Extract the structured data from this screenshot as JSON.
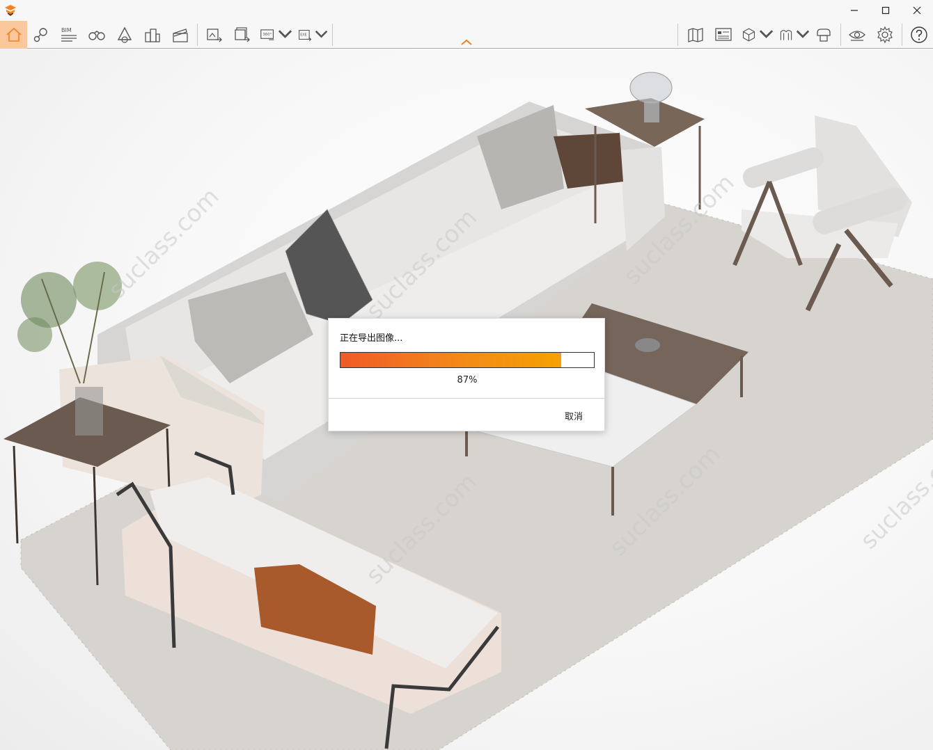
{
  "colors": {
    "accent": "#f58220",
    "home_active_bg": "#fbc79d",
    "progress_start": "#f05a28",
    "progress_end": "#f5a103"
  },
  "titlebar": {
    "icons": [
      "app-logo-icon",
      "minimize-icon",
      "maximize-icon",
      "close-icon"
    ]
  },
  "toolbar": {
    "bim_label": "BIM",
    "icon_360_label": "360°",
    "icon_exe_label": "EXE",
    "icons": [
      "home-icon",
      "location-icon",
      "bim-icon",
      "binoculars-icon",
      "scene-effect-icon",
      "buildings-icon",
      "clapboard-icon",
      "export-image-icon",
      "batch-export-icon",
      "export-360-icon",
      "export-exe-icon",
      "map-icon",
      "dashboard-icon",
      "cube-icon",
      "gate-icon",
      "cloud-render-icon",
      "eye-icon",
      "settings-icon",
      "help-icon"
    ]
  },
  "viewport": {
    "watermark_text": "suclass.com"
  },
  "dialog": {
    "title": "正在导出图像...",
    "progress": 0.87,
    "percent_label": "87%",
    "cancel_label": "取消"
  }
}
